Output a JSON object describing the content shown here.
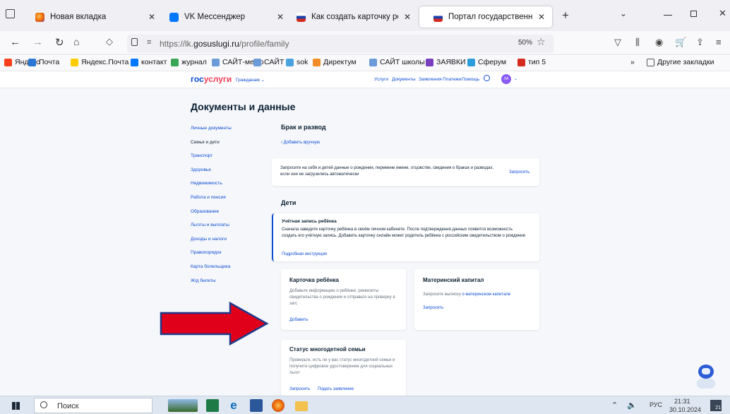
{
  "tabs": [
    {
      "title": "Новая вкладка",
      "favicon_color": "#e66000"
    },
    {
      "title": "VK Мессенджер",
      "favicon_color": "#0077ff"
    },
    {
      "title": "Как создать карточку ребёнка",
      "favicon_color": "#d52b1e"
    },
    {
      "title": "Портал государственных услу",
      "favicon_color": "#d52b1e"
    }
  ],
  "tab_close": "✕",
  "new_tab": "+",
  "url": {
    "prefix": "https://lk.",
    "domain": "gosuslugi.ru",
    "path": "/profile/family"
  },
  "zoom": "50%",
  "bookmarks": [
    {
      "label": "Яндекс",
      "color": "#fc3f1d"
    },
    {
      "label": "Почта",
      "color": "#2a77d8"
    },
    {
      "label": "Яндекс.Почта",
      "color": "#ffcc00"
    },
    {
      "label": "контакт",
      "color": "#0077ff"
    },
    {
      "label": "журнал",
      "color": "#3aa655"
    },
    {
      "label": "САЙТ-меню",
      "color": "#6b9bd8"
    },
    {
      "label": "САЙТ",
      "color": "#6b9bd8"
    },
    {
      "label": "sok",
      "color": "#4aa3df"
    },
    {
      "label": "Директум",
      "color": "#f28c28"
    },
    {
      "label": "САЙТ школы",
      "color": "#6b9bd8"
    },
    {
      "label": "ЗАЯВКИ",
      "color": "#7a3fbf"
    },
    {
      "label": "Сферум",
      "color": "#2d9cdb"
    },
    {
      "label": "тип 5",
      "color": "#d52b1e"
    }
  ],
  "bookmarks_more": "»",
  "other_bookmarks": "Другие закладки",
  "gos": {
    "logo_part1": "гос",
    "logo_part2": "услуги",
    "citizen": "Гражданам ⌄",
    "nav": [
      "Услуги",
      "Документы",
      "Заявления",
      "Платежи",
      "Помощь"
    ],
    "avatar": "ЛА",
    "page_title": "Документы и данные",
    "sidebar": [
      "Личные документы",
      "Семья и дети",
      "Транспорт",
      "Здоровье",
      "Недвижимость",
      "Работа и пенсия",
      "Образование",
      "Льготы и выплаты",
      "Доходы и налоги",
      "Правопорядок",
      "Карта болельщика",
      "Ж/д билеты"
    ],
    "marriage": {
      "title": "Брак и развод",
      "add_manual": "Добавить вручную"
    },
    "request_card": {
      "text": "Запросите на себя и детей данные о рождении, перемене имени, отцовстве, сведения о браках и разводах, если они не загрузились автоматически",
      "button": "Запросить"
    },
    "children_title": "Дети",
    "child_account": {
      "title": "Учётная запись ребёнка",
      "text": "Сначала заведите карточку ребёнка в своём личном кабинете. После подтверждения данных появится возможность создать его учётную запись. Добавить карточку онлайн может родитель ребёнка с российским свидетельством о рождении",
      "link": "Подробная инструкция"
    },
    "child_card": {
      "title": "Карточка ребёнка",
      "text": "Добавьте информацию о ребёнке, реквизиты свидетельства о рождении и отправьте на проверку в загс",
      "link": "Добавить"
    },
    "maternity": {
      "title": "Материнский капитал",
      "text_before": "Запросите выписку ",
      "text_link": "о материнском капитале",
      "link": "Запросить"
    },
    "large_family": {
      "title": "Статус многодетной семьи",
      "text": "Проверьте, есть ли у вас статус многодетной семьи и получите цифровое удостоверение для социальных льгот",
      "link1": "Запросить",
      "link2": "Подать заявление"
    }
  },
  "taskbar": {
    "search": "Поиск",
    "lang": "РУС",
    "time": "21:31",
    "date": "30.10.2024",
    "notif": "21"
  },
  "colors": {
    "arrow": "#e0001a",
    "gos_blue": "#0d4cd3",
    "gos_red": "#ee3f58"
  }
}
